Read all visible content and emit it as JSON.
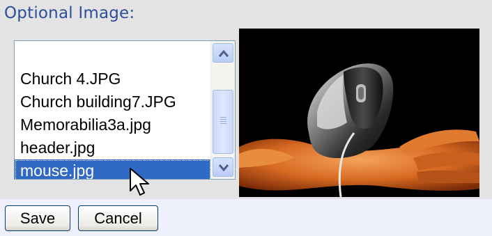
{
  "form": {
    "title": "Optional Image:"
  },
  "listbox": {
    "items": [
      {
        "label": "Church 4.JPG"
      },
      {
        "label": "Church building7.JPG"
      },
      {
        "label": "Memorabilia3a.jpg"
      },
      {
        "label": "header.jpg"
      },
      {
        "label": "mouse.jpg",
        "selected": true
      }
    ],
    "selected_value": "mouse.jpg"
  },
  "preview": {
    "subject": "computer mouse held in hand"
  },
  "buttons": {
    "save_label": "Save",
    "cancel_label": "Cancel"
  },
  "colors": {
    "title_text": "#2d4f9a",
    "selection": "#316ac5",
    "panel_bg": "#e3e3e3",
    "button_bar_bg": "#eef1fb"
  }
}
